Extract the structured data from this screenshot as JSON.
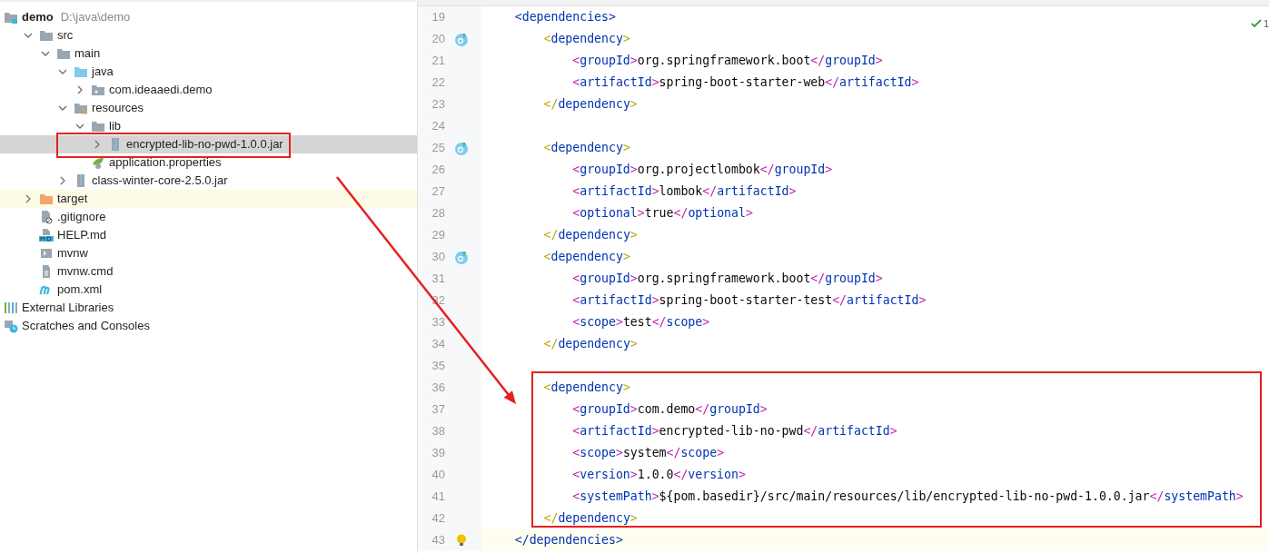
{
  "project_tree": [
    {
      "label": "demo",
      "path": "D:\\java\\demo",
      "kind": "module",
      "selected": false,
      "children": [
        {
          "label": "src",
          "kind": "folder",
          "selected": false,
          "expanded": true,
          "children": [
            {
              "label": "main",
              "kind": "folder",
              "selected": false,
              "expanded": true,
              "children": [
                {
                  "label": "java",
                  "kind": "source_folder",
                  "selected": false,
                  "expanded": true,
                  "children": [
                    {
                      "label": "com.ideaaedi.demo",
                      "kind": "package",
                      "selected": false,
                      "expanded": false
                    }
                  ]
                },
                {
                  "label": "resources",
                  "kind": "resources",
                  "selected": false,
                  "expanded": true,
                  "children": [
                    {
                      "label": "lib",
                      "kind": "folder",
                      "selected": false,
                      "expanded": true,
                      "children": [
                        {
                          "label": "encrypted-lib-no-pwd-1.0.0.jar",
                          "kind": "jar",
                          "selected": true,
                          "expanded": false
                        }
                      ]
                    },
                    {
                      "label": "application.properties",
                      "kind": "properties",
                      "selected": false
                    }
                  ]
                },
                {
                  "label": "class-winter-core-2.5.0.jar",
                  "kind": "jar",
                  "selected": false,
                  "expanded": false
                }
              ]
            }
          ]
        },
        {
          "label": "target",
          "kind": "excluded_folder",
          "selected": false,
          "expanded": false
        },
        {
          "label": ".gitignore",
          "kind": "ignore_file",
          "selected": false
        },
        {
          "label": "HELP.md",
          "kind": "markdown",
          "selected": false
        },
        {
          "label": "mvnw",
          "kind": "script",
          "selected": false
        },
        {
          "label": "mvnw.cmd",
          "kind": "text_file",
          "selected": false
        },
        {
          "label": "pom.xml",
          "kind": "maven",
          "selected": false
        }
      ]
    },
    {
      "label": "External Libraries",
      "kind": "libraries",
      "selected": false
    },
    {
      "label": "Scratches and Consoles",
      "kind": "scratches",
      "selected": false
    }
  ],
  "editor": {
    "inspection_count": "1",
    "lines": [
      {
        "number": "19",
        "text": "    <dependencies>",
        "kind": "plain",
        "current": false
      },
      {
        "number": "20",
        "text": "        <dependency>",
        "kind": "override",
        "current": false
      },
      {
        "number": "21",
        "text": "            <groupId>org.springframework.boot</groupId>",
        "kind": "plain",
        "current": false
      },
      {
        "number": "22",
        "text": "            <artifactId>spring-boot-starter-web</artifactId>",
        "kind": "plain",
        "current": false
      },
      {
        "number": "23",
        "text": "        </dependency>",
        "kind": "plain",
        "current": false
      },
      {
        "number": "24",
        "kind": "plain",
        "current": false
      },
      {
        "number": "25",
        "text": "        <dependency>",
        "kind": "override",
        "current": false
      },
      {
        "number": "26",
        "text": "            <groupId>org.projectlombok</groupId>",
        "kind": "plain",
        "current": false
      },
      {
        "number": "27",
        "text": "            <artifactId>lombok</artifactId>",
        "kind": "plain",
        "current": false
      },
      {
        "number": "28",
        "text": "            <optional>true</optional>",
        "kind": "plain",
        "current": false
      },
      {
        "number": "29",
        "text": "        </dependency>",
        "kind": "plain",
        "current": false
      },
      {
        "number": "30",
        "text": "        <dependency>",
        "kind": "override",
        "current": false
      },
      {
        "number": "31",
        "text": "            <groupId>org.springframework.boot</groupId>",
        "kind": "plain",
        "current": false
      },
      {
        "number": "32",
        "text": "            <artifactId>spring-boot-starter-test</artifactId>",
        "kind": "plain",
        "current": false
      },
      {
        "number": "33",
        "text": "            <scope>test</scope>",
        "kind": "plain",
        "current": false
      },
      {
        "number": "34",
        "text": "        </dependency>",
        "kind": "plain",
        "current": false
      },
      {
        "number": "35",
        "kind": "plain",
        "current": false
      },
      {
        "number": "36",
        "text": "        <dependency>",
        "kind": "plain",
        "current": false
      },
      {
        "number": "37",
        "text": "            <groupId>com.demo</groupId>",
        "kind": "plain",
        "current": false
      },
      {
        "number": "38",
        "text": "            <artifactId>encrypted-lib-no-pwd</artifactId>",
        "kind": "plain",
        "current": false
      },
      {
        "number": "39",
        "text": "            <scope>system</scope>",
        "kind": "plain",
        "current": false
      },
      {
        "number": "40",
        "text": "            <version>1.0.0</version>",
        "kind": "plain",
        "current": false
      },
      {
        "number": "41",
        "text": "            <systemPath>${pom.basedir}/src/main/resources/lib/encrypted-lib-no-pwd-1.0.0.jar</systemPath>",
        "kind": "plain",
        "current": false
      },
      {
        "number": "42",
        "text": "        </dependency>",
        "kind": "plain",
        "current": false
      },
      {
        "number": "43",
        "text": "    </dependencies>",
        "kind": "bulb",
        "current": true
      }
    ]
  }
}
